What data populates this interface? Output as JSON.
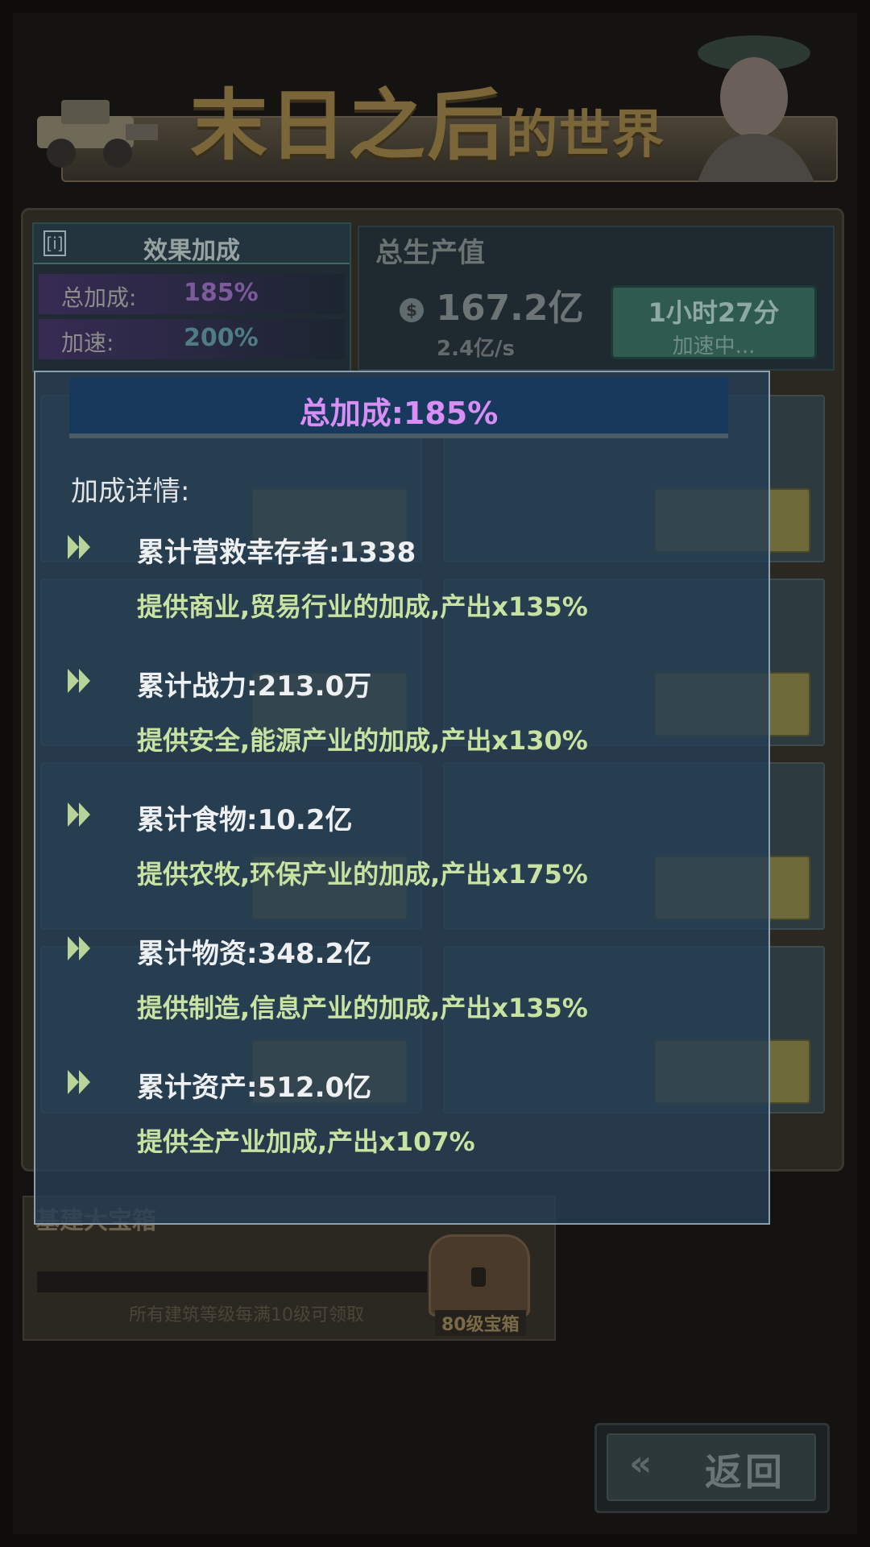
{
  "header": {
    "title_big": "末日之后",
    "title_small": "的世界"
  },
  "bonus_panel": {
    "title": "效果加成",
    "info_icon": "[i]",
    "rows": [
      {
        "label": "总加成:",
        "value": "185%",
        "color": "#7d5a9c"
      },
      {
        "label": "加速:",
        "value": "200%",
        "color": "#4f7d86"
      }
    ]
  },
  "production": {
    "title": "总生产值",
    "total": "167.2亿",
    "rate": "2.4亿/s",
    "timer": "1小时27分",
    "timer_status": "加速中..."
  },
  "chest": {
    "title": "基建大宝箱",
    "description": "所有建筑等级每满10级可领取",
    "label": "80级宝箱"
  },
  "back_button": {
    "label": "返回"
  },
  "modal": {
    "title": "总加成:185%",
    "detail_label": "加成详情:",
    "stats": [
      {
        "text": "累计营救幸存者:1338",
        "desc": "提供商业,贸易行业的加成,产出x135%"
      },
      {
        "text": "累计战力:213.0万",
        "desc": "提供安全,能源产业的加成,产出x130%"
      },
      {
        "text": "累计食物:10.2亿",
        "desc": "提供农牧,环保产业的加成,产出x175%"
      },
      {
        "text": "累计物资:348.2亿",
        "desc": "提供制造,信息产业的加成,产出x135%"
      },
      {
        "text": "累计资产:512.0亿",
        "desc": "提供全产业加成,产出x107%"
      }
    ]
  },
  "colors": {
    "modal_title": "#d98ef5",
    "desc": "#c8e2a2",
    "arrow": "#b9d49a"
  },
  "icons": [
    "info-icon",
    "coin-icon",
    "chest-icon",
    "back-arrow-icon",
    "arrow-right-icon"
  ]
}
